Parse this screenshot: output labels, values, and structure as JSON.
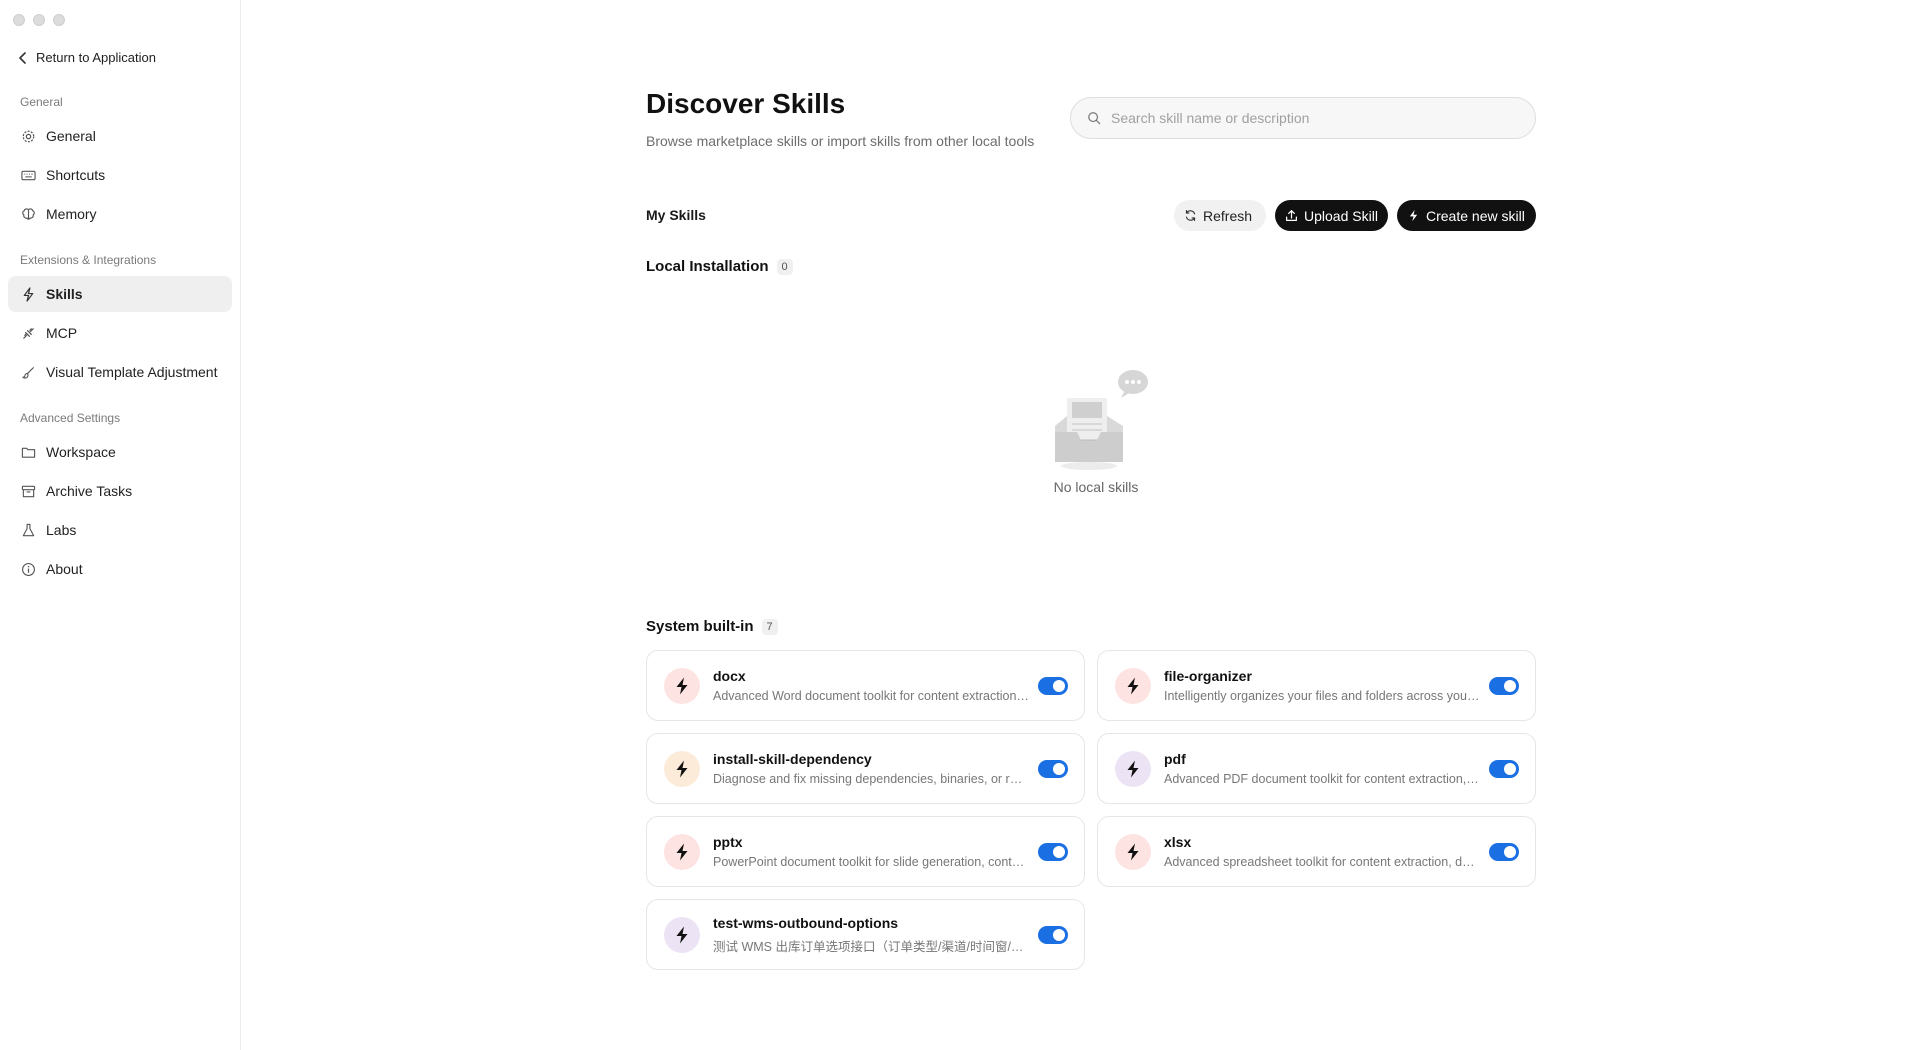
{
  "window": {
    "controls": [
      "close",
      "minimize",
      "maximize"
    ]
  },
  "sidebar": {
    "back_label": "Return to Application",
    "sections": [
      {
        "label": "General",
        "items": [
          {
            "label": "General",
            "icon": "gear-icon"
          },
          {
            "label": "Shortcuts",
            "icon": "keyboard-icon"
          },
          {
            "label": "Memory",
            "icon": "brain-icon"
          }
        ]
      },
      {
        "label": "Extensions & Integrations",
        "items": [
          {
            "label": "Skills",
            "icon": "bolt-icon",
            "active": true
          },
          {
            "label": "MCP",
            "icon": "plug-icon"
          },
          {
            "label": "Visual Template Adjustment",
            "icon": "brush-icon"
          }
        ]
      },
      {
        "label": "Advanced Settings",
        "items": [
          {
            "label": "Workspace",
            "icon": "folder-icon"
          },
          {
            "label": "Archive Tasks",
            "icon": "archive-icon"
          },
          {
            "label": "Labs",
            "icon": "flask-icon"
          },
          {
            "label": "About",
            "icon": "info-icon"
          }
        ]
      }
    ]
  },
  "header": {
    "title": "Discover Skills",
    "subtitle": "Browse marketplace skills or import skills from other local tools"
  },
  "search": {
    "placeholder": "Search skill name or description",
    "value": ""
  },
  "toolbar": {
    "section_label": "My Skills",
    "refresh_label": "Refresh",
    "upload_label": "Upload Skill",
    "create_label": "Create new skill"
  },
  "local": {
    "title": "Local Installation",
    "count": "0",
    "empty_text": "No local skills"
  },
  "builtin": {
    "title": "System built-in",
    "count": "7",
    "skills": [
      {
        "name": "docx",
        "description": "Advanced Word document toolkit for content extraction, document generation, editing and formatting",
        "icon_bg": "#fde3e1",
        "enabled": true
      },
      {
        "name": "file-organizer",
        "description": "Intelligently organizes your files and folders across your computer by understanding context",
        "icon_bg": "#fde3e1",
        "enabled": true
      },
      {
        "name": "install-skill-dependency",
        "description": "Diagnose and fix missing dependencies, binaries, or runtime packages required by skills",
        "icon_bg": "#fdebd9",
        "enabled": true
      },
      {
        "name": "pdf",
        "description": "Advanced PDF document toolkit for content extraction, generation, merging and form filling",
        "icon_bg": "#ece3f5",
        "enabled": true
      },
      {
        "name": "pptx",
        "description": "PowerPoint document toolkit for slide generation, content editing and layout adjustment",
        "icon_bg": "#fde3e1",
        "enabled": true
      },
      {
        "name": "xlsx",
        "description": "Advanced spreadsheet toolkit for content extraction, document generation and data analysis",
        "icon_bg": "#fde3e1",
        "enabled": true
      },
      {
        "name": "test-wms-outbound-options",
        "description": "测试 WMS 出库订单选项接口（订单类型/渠道/时间窗/订单状态）",
        "icon_bg": "#ece3f5",
        "enabled": true
      }
    ]
  }
}
